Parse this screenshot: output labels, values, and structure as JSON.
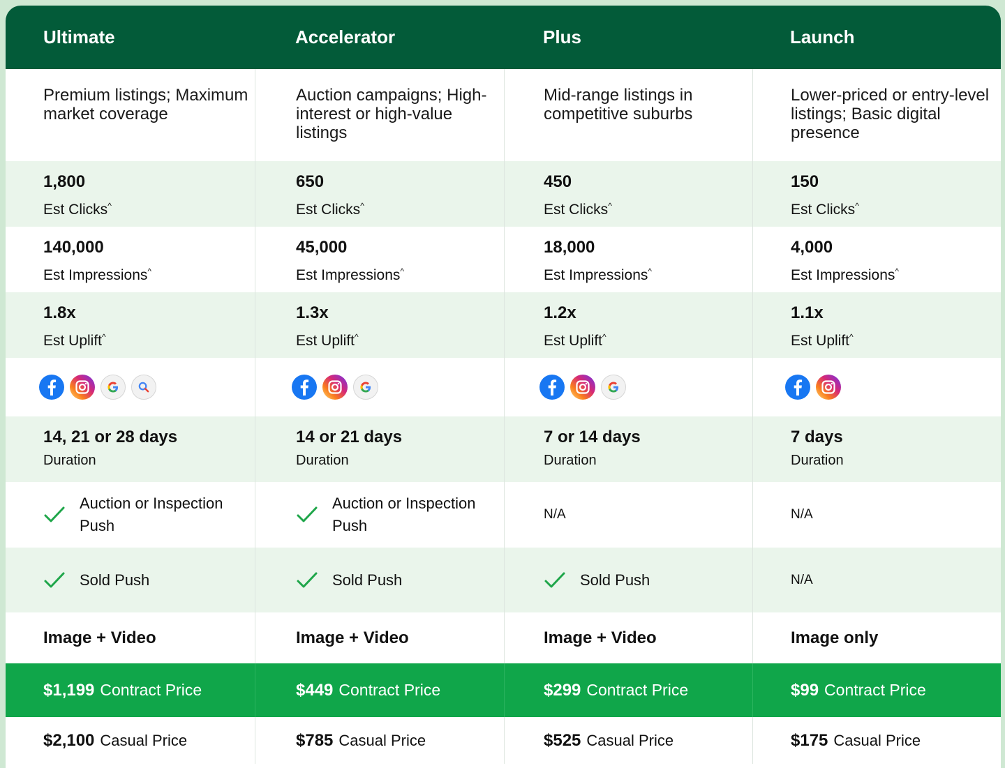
{
  "columns": [
    {
      "name": "Ultimate",
      "description": "Premium listings; Maximum market coverage",
      "clicks": "1,800",
      "impressions": "140,000",
      "uplift": "1.8x",
      "channels": [
        "facebook-icon",
        "instagram-icon",
        "google-icon",
        "search-icon"
      ],
      "duration": "14, 21 or 28 days",
      "auction_push": "Auction or Inspection Push",
      "sold_push": "Sold Push",
      "media": "Image + Video",
      "contract_price": "$1,199",
      "casual_price": "$2,100"
    },
    {
      "name": "Accelerator",
      "description": "Auction campaigns; High-interest or high-value listings",
      "clicks": "650",
      "impressions": "45,000",
      "uplift": "1.3x",
      "channels": [
        "facebook-icon",
        "instagram-icon",
        "google-icon"
      ],
      "duration": "14 or 21 days",
      "auction_push": "Auction or Inspection Push",
      "sold_push": "Sold Push",
      "media": "Image + Video",
      "contract_price": "$449",
      "casual_price": "$785"
    },
    {
      "name": "Plus",
      "description": "Mid-range listings in competitive suburbs",
      "clicks": "450",
      "impressions": "18,000",
      "uplift": "1.2x",
      "channels": [
        "facebook-icon",
        "instagram-icon",
        "google-icon"
      ],
      "duration": "7 or 14 days",
      "auction_push": "N/A",
      "sold_push": "Sold Push",
      "media": "Image + Video",
      "contract_price": "$299",
      "casual_price": "$525"
    },
    {
      "name": "Launch",
      "description": "Lower-priced or entry-level listings; Basic digital presence",
      "clicks": "150",
      "impressions": "4,000",
      "uplift": "1.1x",
      "channels": [
        "facebook-icon",
        "instagram-icon"
      ],
      "duration": "7 days",
      "auction_push": "N/A",
      "sold_push": "N/A",
      "media": "Image only",
      "contract_price": "$99",
      "casual_price": "$175"
    }
  ],
  "labels": {
    "clicks": "Est Clicks",
    "impressions": "Est Impressions",
    "uplift": "Est Uplift",
    "footnote_mark": "^",
    "duration": "Duration",
    "contract_price": "Contract Price",
    "casual_price": "Casual Price"
  },
  "colors": {
    "header_bg": "#035b39",
    "contract_bg": "#10a64a",
    "tint_row": "#eaf5eb",
    "check": "#1fa64a",
    "page_bg": "#cfe8d3"
  }
}
